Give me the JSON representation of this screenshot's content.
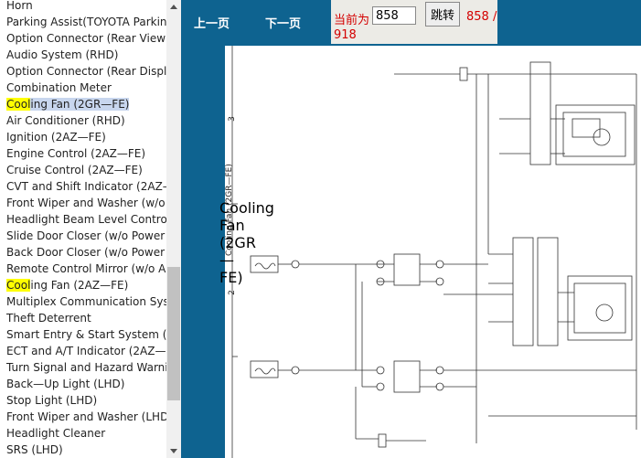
{
  "sidebar": {
    "items": [
      {
        "text": "Horn"
      },
      {
        "text": "Parking Assist(TOYOTA Parking"
      },
      {
        "text": "Option Connector (Rear View M"
      },
      {
        "text": "Audio System (RHD)"
      },
      {
        "text": "Option Connector (Rear Displa"
      },
      {
        "text": "Combination Meter"
      },
      {
        "hl": "Cool",
        "text": "ing Fan (2GR—FE)",
        "selected": true
      },
      {
        "text": "Air Conditioner (RHD)"
      },
      {
        "text": "Ignition (2AZ—FE)"
      },
      {
        "text": "Engine Control (2AZ—FE)"
      },
      {
        "text": "Cruise Control (2AZ—FE)"
      },
      {
        "text": "CVT and Shift Indicator (2AZ—"
      },
      {
        "text": "Front Wiper and Washer (w/o A"
      },
      {
        "text": "Headlight Beam Level Control("
      },
      {
        "text": "Slide Door Closer (w/o Power"
      },
      {
        "text": "Back Door Closer (w/o Power"
      },
      {
        "text": "Remote Control Mirror (w/o Au"
      },
      {
        "hl": "Cool",
        "text": "ing Fan (2AZ—FE)"
      },
      {
        "text": "Multiplex Communication Syste"
      },
      {
        "text": "Theft Deterrent"
      },
      {
        "text": "Smart Entry & Start System (L"
      },
      {
        "text": "ECT and A/T Indicator (2AZ—F"
      },
      {
        "text": "Turn Signal and Hazard Warnin"
      },
      {
        "text": "Back—Up Light (LHD)"
      },
      {
        "text": "Stop Light (LHD)"
      },
      {
        "text": "Front Wiper and Washer (LHD"
      },
      {
        "text": "Headlight Cleaner"
      },
      {
        "text": "SRS (LHD)"
      }
    ]
  },
  "toolbar": {
    "prev_label": "上一页",
    "next_label": "下一页",
    "current_label": "当前为",
    "page_input_value": "858",
    "go_label": "跳转",
    "page_num": "858 /",
    "page_total": "918"
  },
  "diagram": {
    "title": "Cooling Fan (2GR—FE)",
    "marker_3": "3",
    "marker_2": "2"
  },
  "colors": {
    "frame_blue": "#0e6390",
    "highlight_yellow": "#ffff00",
    "selected_bg": "#c8d6ee",
    "pager_red": "#d40000"
  }
}
